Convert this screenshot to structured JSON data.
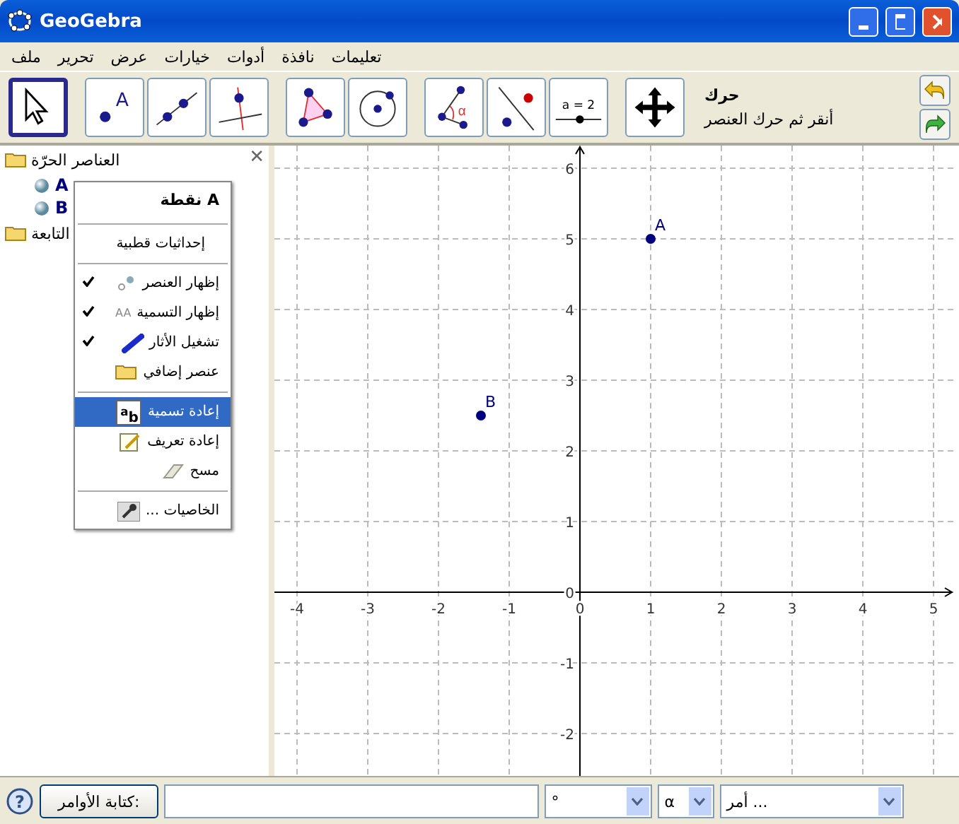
{
  "window": {
    "title": "GeoGebra"
  },
  "menu_bar": [
    "تعليمات",
    "نافذة",
    "أدوات",
    "خيارات",
    "عرض",
    "تحرير",
    "ملف"
  ],
  "toolbar": {
    "tools": [
      {
        "selected": true
      },
      {
        "selected": false,
        "icon_text": "A"
      },
      {
        "selected": false
      },
      {
        "selected": false
      },
      {
        "selected": false
      },
      {
        "selected": false
      },
      {
        "selected": false,
        "icon_text": "α"
      },
      {
        "selected": false
      },
      {
        "selected": false,
        "icon_text": "a = 2"
      },
      {
        "selected": false
      }
    ],
    "tool_name": "حرك",
    "tool_help": "أنقر ثم حرك العنصر"
  },
  "algebra_view": {
    "close": "✕",
    "folders": [
      {
        "label": "العناصر الحرّة",
        "children": [
          "A",
          "B"
        ]
      },
      {
        "label": "التابعة"
      }
    ]
  },
  "context_menu": {
    "title": "نقطة A",
    "groups": [
      [
        {
          "kind": "plain",
          "label": "إحداثيات قطبية",
          "selected": false
        }
      ],
      [
        {
          "kind": "toggle",
          "label": "إظهار العنصر",
          "checked": true,
          "selected": false
        },
        {
          "kind": "toggle",
          "label": "إظهار التسمية",
          "checked": true,
          "selected": false,
          "icon_text": "AA"
        },
        {
          "kind": "toggle",
          "label": "تشغيل الأثار",
          "checked": true,
          "selected": false
        },
        {
          "kind": "folder",
          "label": "عنصر إضافي",
          "selected": false
        }
      ],
      [
        {
          "kind": "rename",
          "label": "إعادة تسمية",
          "selected": true,
          "icon_text": "$^{a}$b"
        },
        {
          "kind": "redefine",
          "label": "إعادة تعريف",
          "selected": false
        },
        {
          "kind": "delete",
          "label": "مسح",
          "selected": false
        }
      ],
      [
        {
          "kind": "properties",
          "label": "الخاصيات ...",
          "selected": false
        }
      ]
    ]
  },
  "graphics": {
    "chart_data": {
      "type": "scatter",
      "x": [
        1,
        -1.4
      ],
      "series": [
        {
          "color": "#00007f",
          "values": [
            5,
            2.5
          ]
        }
      ],
      "grid": true,
      "xlim": [
        -4.32,
        5.28
      ],
      "ylim": [
        -2.6,
        6.32
      ],
      "xticks": [
        -4,
        -3,
        -2,
        -1,
        0,
        1,
        2,
        3,
        4,
        5
      ],
      "yticks": [
        -2,
        -1,
        0,
        1,
        2,
        3,
        4,
        5,
        6
      ],
      "annotations": [
        {
          "text": "A",
          "x": 1,
          "y": 5
        },
        {
          "text": "B",
          "x": -1.4,
          "y": 2.5
        }
      ]
    }
  },
  "input_bar": {
    "help": "?",
    "button": "كتابة الأوامر:",
    "degree": "°",
    "symbol": "α",
    "command": "أمر ..."
  }
}
